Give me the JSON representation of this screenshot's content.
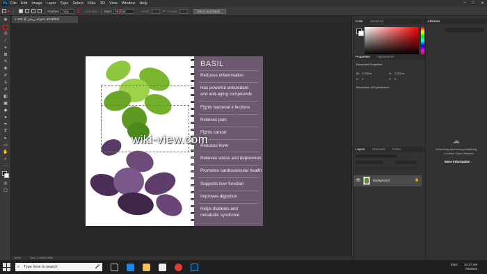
{
  "menubar": {
    "logo": "Ps",
    "items": [
      "File",
      "Edit",
      "Image",
      "Layer",
      "Type",
      "Select",
      "Filter",
      "3D",
      "View",
      "Window",
      "Help"
    ],
    "window_controls": [
      "–",
      "□",
      "✕"
    ]
  },
  "options": {
    "feather_label": "Feather:",
    "feather_value": "0 px",
    "antialias_label": "Anti-alias",
    "style_label": "Style:",
    "style_value": "Normal",
    "width_label": "Width:",
    "height_label": "Height:",
    "select_mask_label": "Select and Mask...",
    "mark_1": "1",
    "mark_2": "2"
  },
  "document_tab": {
    "title": "فوائد ریحان @ 100% (RGB/8#)",
    "close": "×"
  },
  "toolbar": {
    "mark": "1"
  },
  "canvas": {
    "title": "BASIL",
    "benefits": [
      {
        "line1": "Reduces inflammation",
        "line2": ""
      },
      {
        "line1": "Has powerful antioxidant",
        "line2": "and anti-aging compounds"
      },
      {
        "line1": "Fights bacterial infections",
        "line2": ""
      },
      {
        "line1": "Relieves pain",
        "line2": ""
      },
      {
        "line1": "Fights cancer",
        "line2": ""
      },
      {
        "line1": "Reduces fever",
        "line2": ""
      },
      {
        "line1": "Relieves stress and depression",
        "line2": ""
      },
      {
        "line1": "Promotes cardiovascular health",
        "line2": ""
      },
      {
        "line1": "Supports liver function",
        "line2": ""
      },
      {
        "line1": "Improves digestion",
        "line2": ""
      },
      {
        "line1": "Helps diabetes and",
        "line2": "metabolic syndrome"
      }
    ],
    "watermark": "wiki-view.com"
  },
  "panels": {
    "color_tab": "Color",
    "swatches_tab": "Swatches",
    "properties_tab": "Properties",
    "adjustments_tab": "Adjustments",
    "doc_properties": "Document Properties",
    "w_label": "W:",
    "w_value": "3.333 in",
    "h_label": "H:",
    "h_value": "3.333 in",
    "x_label": "X:",
    "x_value": "0",
    "y_label": "Y:",
    "y_value": "0",
    "resolution": "Resolution: 300 pixels/inch",
    "layers_tab": "Layers",
    "channels_tab": "Channels",
    "paths_tab": "Paths",
    "layer_name": "Background"
  },
  "libraries": {
    "tab": "Libraries",
    "error_line1": "Something went wrong initializing",
    "error_line2": "Creative Cloud Libraries",
    "more_info": "More information"
  },
  "statusbar": {
    "zoom": "100%",
    "doc": "Doc: 1.10M/1.08M"
  },
  "taskbar": {
    "search_placeholder": "Type here to search",
    "lang": "ENG",
    "time": "10:17 AM",
    "date": "7/6/2019"
  },
  "colors": {
    "ps_blue": "#31a8ff",
    "basil_panel": "#6e5a70",
    "annotation_red": "#e02020"
  }
}
